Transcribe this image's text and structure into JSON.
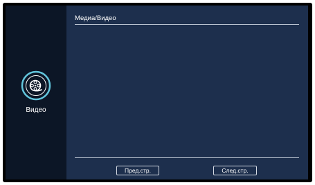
{
  "header": {
    "breadcrumb": "Медиа/Видео"
  },
  "sidebar": {
    "items": [
      {
        "label": "Видео",
        "icon": "film-reel-icon",
        "selected": true
      }
    ]
  },
  "pagination": {
    "prev_label": "Пред.стр.",
    "next_label": "След.стр."
  },
  "colors": {
    "frame": "#000000",
    "sidebar_bg": "#0c1626",
    "content_bg": "#1d2f4d",
    "icon_ring": "#63c6dd",
    "text": "#ffffff",
    "divider": "#b9c2d0"
  }
}
